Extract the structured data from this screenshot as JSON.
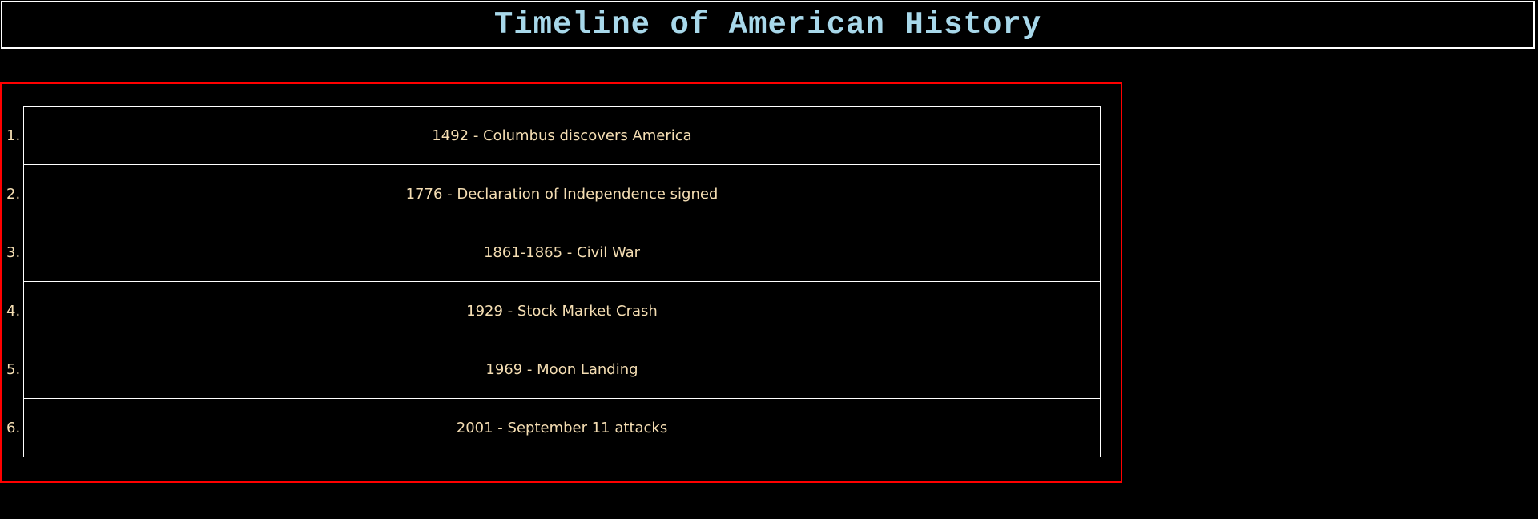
{
  "header": {
    "title": "Timeline of American History"
  },
  "timeline": {
    "items": [
      {
        "number": "1.",
        "text": "1492 - Columbus discovers America"
      },
      {
        "number": "2.",
        "text": "1776 - Declaration of Independence signed"
      },
      {
        "number": "3.",
        "text": "1861-1865 - Civil War"
      },
      {
        "number": "4.",
        "text": "1929 - Stock Market Crash"
      },
      {
        "number": "5.",
        "text": "1969 - Moon Landing"
      },
      {
        "number": "6.",
        "text": "2001 - September 11 attacks"
      }
    ]
  },
  "colors": {
    "background": "#000000",
    "title": "#a8d8ea",
    "item_text": "#f5deb3",
    "item_border": "#ffffff",
    "container_border": "#ff0000"
  }
}
